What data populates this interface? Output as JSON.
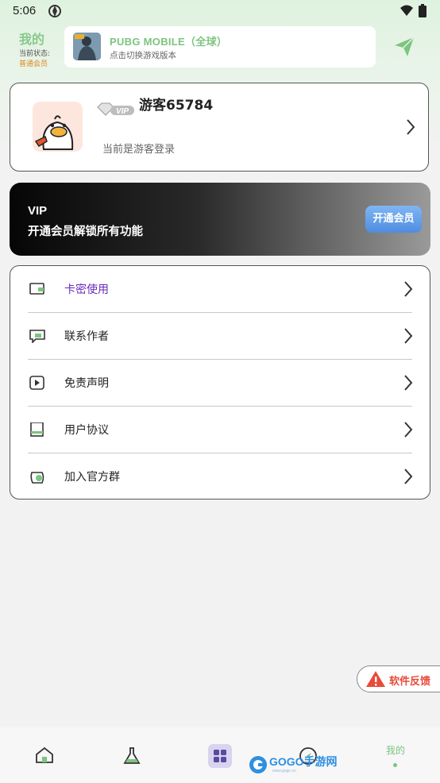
{
  "status_bar": {
    "time": "5:06"
  },
  "header": {
    "title": "我的",
    "state_label": "当前状态:",
    "state_value": "普通会员",
    "game_name": "PUBG MOBILE（全球）",
    "game_subtitle": "点击切换游戏版本"
  },
  "profile": {
    "username": "游客65784",
    "vip_badge": "VIP",
    "login_note": "当前是游客登录"
  },
  "vip_banner": {
    "title": "VIP",
    "subtitle": "开通会员解锁所有功能",
    "button_label": "开通会员"
  },
  "menu": {
    "items": [
      {
        "label": "卡密使用",
        "icon": "card-icon",
        "color": "#6a2bb8"
      },
      {
        "label": "联系作者",
        "icon": "chat-icon"
      },
      {
        "label": "免责声明",
        "icon": "play-icon"
      },
      {
        "label": "用户协议",
        "icon": "book-icon"
      },
      {
        "label": "加入官方群",
        "icon": "group-icon"
      }
    ]
  },
  "feedback": {
    "label": "软件反馈"
  },
  "bottom_nav": {
    "items": [
      {
        "icon": "home-icon"
      },
      {
        "icon": "flask-icon"
      },
      {
        "icon": "grid-icon"
      },
      {
        "icon": "compass-icon"
      },
      {
        "label": "我的"
      }
    ]
  },
  "watermark": {
    "text": "GOGO手游网",
    "sub": "www.gogo.cn"
  },
  "colors": {
    "accent_green": "#7cc47f",
    "orange": "#e0861c",
    "blue_button": "#5a96e6"
  }
}
